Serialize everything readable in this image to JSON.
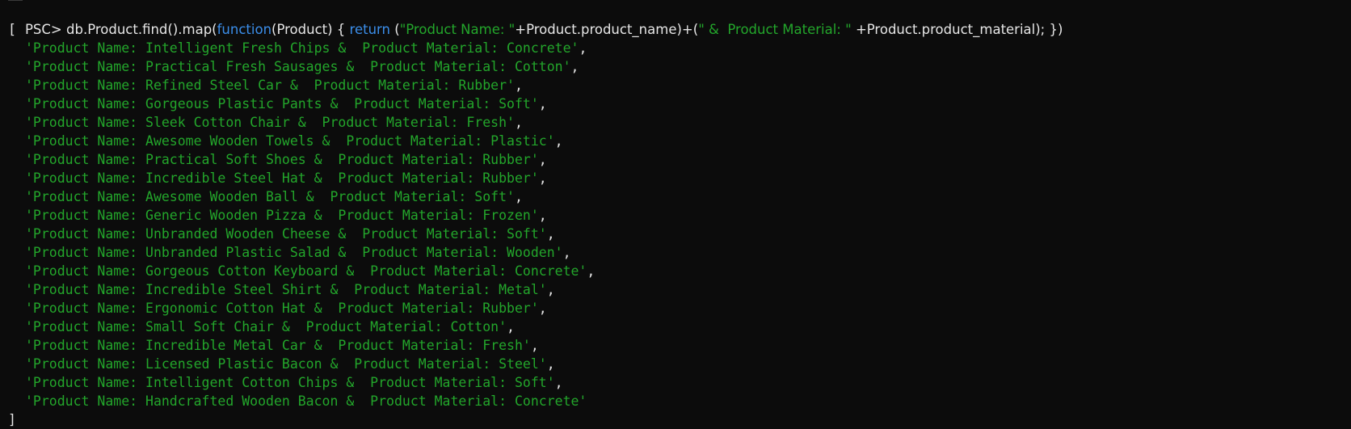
{
  "terminal": {
    "prompt": "PSC> ",
    "command": [
      {
        "text": "db.Product.find().map(",
        "style": "plain"
      },
      {
        "text": "function",
        "style": "kw"
      },
      {
        "text": "(Product) { ",
        "style": "plain"
      },
      {
        "text": "return",
        "style": "kw"
      },
      {
        "text": " (",
        "style": "plain"
      },
      {
        "text": "\"Product Name: \"",
        "style": "str"
      },
      {
        "text": "+Product.product_name)+(",
        "style": "plain"
      },
      {
        "text": "\" &  Product Material: \"",
        "style": "str"
      },
      {
        "text": " +Product.product_material); })",
        "style": "plain"
      }
    ],
    "open_bracket": "[",
    "close_bracket": "]",
    "output": [
      "'Product Name: Intelligent Fresh Chips &  Product Material: Concrete'",
      "'Product Name: Practical Fresh Sausages &  Product Material: Cotton'",
      "'Product Name: Refined Steel Car &  Product Material: Rubber'",
      "'Product Name: Gorgeous Plastic Pants &  Product Material: Soft'",
      "'Product Name: Sleek Cotton Chair &  Product Material: Fresh'",
      "'Product Name: Awesome Wooden Towels &  Product Material: Plastic'",
      "'Product Name: Practical Soft Shoes &  Product Material: Rubber'",
      "'Product Name: Incredible Steel Hat &  Product Material: Rubber'",
      "'Product Name: Awesome Wooden Ball &  Product Material: Soft'",
      "'Product Name: Generic Wooden Pizza &  Product Material: Frozen'",
      "'Product Name: Unbranded Wooden Cheese &  Product Material: Soft'",
      "'Product Name: Unbranded Plastic Salad &  Product Material: Wooden'",
      "'Product Name: Gorgeous Cotton Keyboard &  Product Material: Concrete'",
      "'Product Name: Incredible Steel Shirt &  Product Material: Metal'",
      "'Product Name: Ergonomic Cotton Hat &  Product Material: Rubber'",
      "'Product Name: Small Soft Chair &  Product Material: Cotton'",
      "'Product Name: Incredible Metal Car &  Product Material: Fresh'",
      "'Product Name: Licensed Plastic Bacon &  Product Material: Steel'",
      "'Product Name: Intelligent Cotton Chips &  Product Material: Soft'",
      "'Product Name: Handcrafted Wooden Bacon &  Product Material: Concrete'"
    ],
    "separator": ","
  },
  "colors": {
    "background": "#0c0c0c",
    "text": "#e6e6e6",
    "keyword": "#3b8eea",
    "string": "#23a62b"
  }
}
